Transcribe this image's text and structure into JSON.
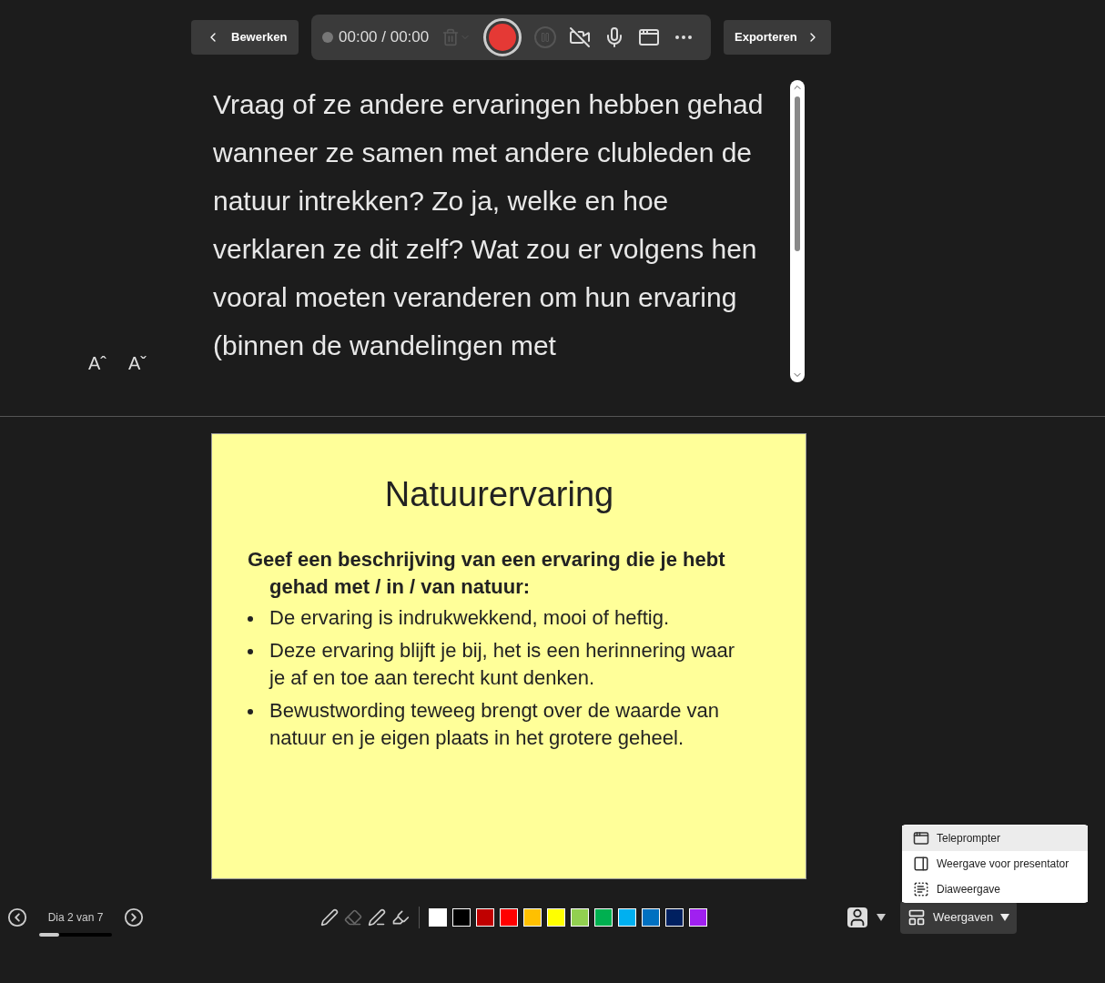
{
  "toolbar": {
    "edit_button": "Bewerken",
    "recording": {
      "time": "00:00 / 00:00",
      "recording_active": false,
      "delete_disabled": true,
      "pause_disabled": true,
      "camera_on": false
    },
    "export_button": "Exporteren"
  },
  "notes": {
    "text": "Vraag of ze andere ervaringen hebben gehad wanneer ze samen met andere clubleden de natuur intrekken? Zo ja, welke en hoe verklaren ze dit zelf? Wat zou er volgens hen vooral moeten veranderen om hun ervaring (binnen de wandelingen met",
    "font_buttons": [
      "Aˆ",
      "Aˇ"
    ]
  },
  "slide": {
    "title": "Natuurervaring",
    "intro": "Geef een beschrijving van een ervaring die je hebt gehad met / in / van natuur:",
    "bullets": [
      "De ervaring is indrukwekkend, mooi of heftig.",
      "Deze ervaring blijft je bij, het is een herinnering waar je af en toe aan terecht kunt denken.",
      "Bewustwording teweeg brengt over de waarde van natuur en je eigen plaats in het grotere geheel."
    ]
  },
  "navigation": {
    "label": "Dia 2 van 7",
    "level": 0.28
  },
  "tools": [
    {
      "kind": "pen",
      "disabled": false
    },
    {
      "kind": "eraser",
      "disabled": true
    },
    {
      "kind": "lasso",
      "disabled": false
    },
    {
      "kind": "highlighter",
      "disabled": false
    }
  ],
  "colors": [
    {
      "color": "#ffffff"
    },
    {
      "color": "#000000"
    },
    {
      "color": "#c00000"
    },
    {
      "color": "#ff0000"
    },
    {
      "color": "#ffc000"
    },
    {
      "color": "#ffff00"
    },
    {
      "color": "#92d050"
    },
    {
      "color": "#00b050"
    },
    {
      "color": "#00b0f0"
    },
    {
      "color": "#0070c0"
    },
    {
      "color": "#002060"
    },
    {
      "color": "#a020f0"
    }
  ],
  "views_button": "Weergaven",
  "views_menu": [
    {
      "label": "Teleprompter",
      "kind": "teleprompter",
      "selected": true
    },
    {
      "label": "Weergave voor presentator",
      "kind": "presenter",
      "selected": false
    },
    {
      "label": "Diaweergave",
      "kind": "slide",
      "selected": false
    }
  ]
}
